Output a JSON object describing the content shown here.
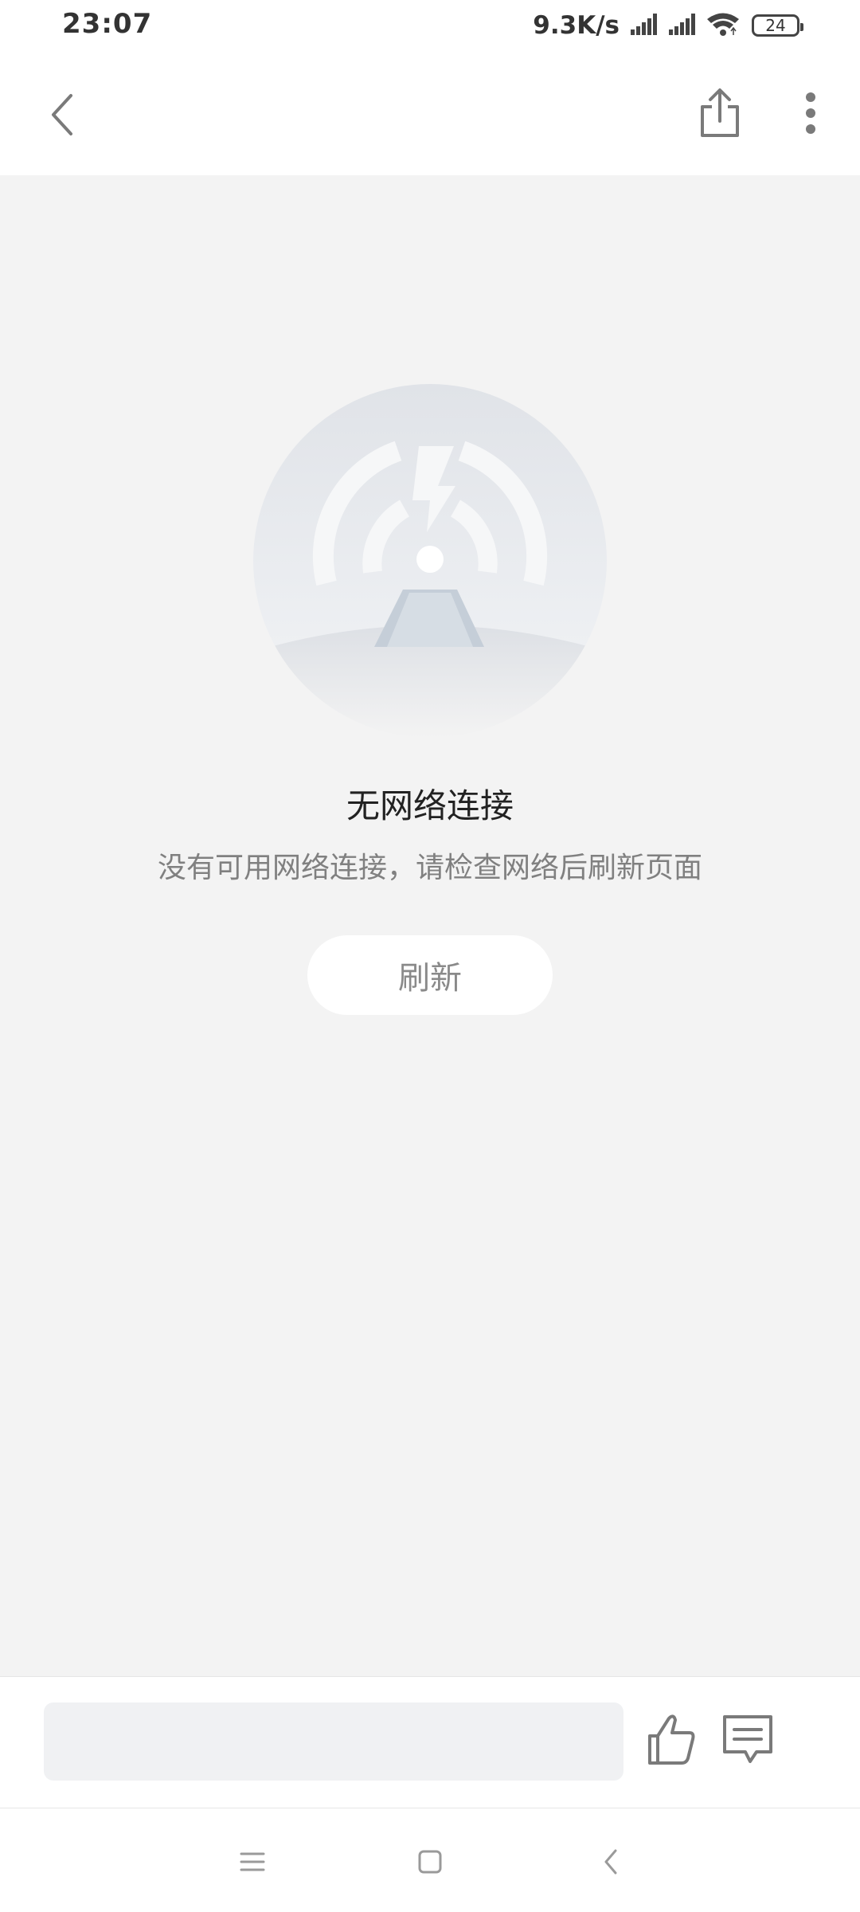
{
  "status_bar": {
    "time": "23:07",
    "net_speed": "9.3K/s",
    "battery": "24",
    "icons": [
      "signal-icon",
      "signal-icon",
      "wifi-icon",
      "battery-icon"
    ]
  },
  "header": {
    "back_icon": "chevron-left-icon",
    "share_icon": "share-icon",
    "more_icon": "more-vertical-icon"
  },
  "error": {
    "illustration": "no-network-illustration",
    "title": "无网络连接",
    "description": "没有可用网络连接，请检查网络后刷新页面",
    "refresh_label": "刷新"
  },
  "bottom_bar": {
    "input_placeholder": "",
    "like_icon": "thumbs-up-icon",
    "comment_icon": "comment-icon"
  },
  "nav_bar": {
    "icons": [
      "menu-icon",
      "home-icon",
      "back-icon"
    ]
  },
  "colors": {
    "content_bg": "#f3f3f3",
    "icon_gray": "#7a7a7a"
  }
}
